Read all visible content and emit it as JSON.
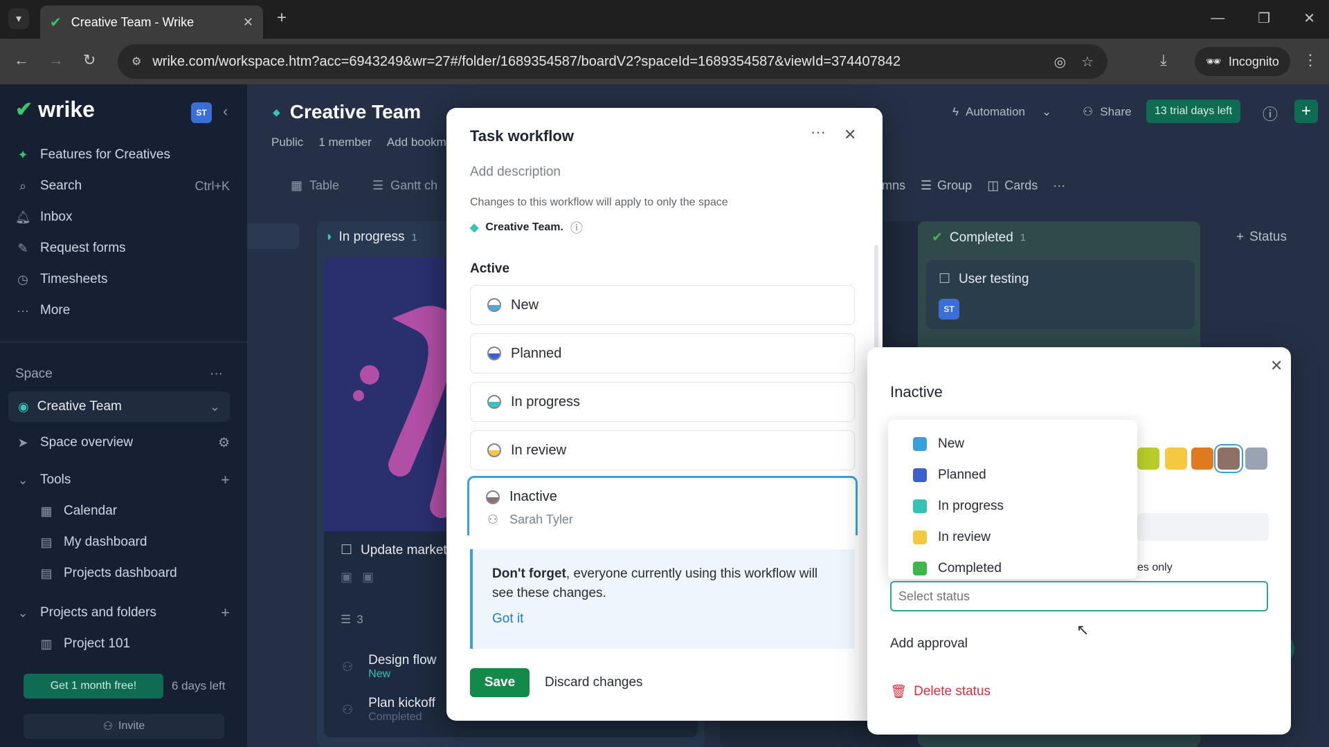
{
  "browser": {
    "tab_title": "Creative Team - Wrike",
    "url": "wrike.com/workspace.htm?acc=6943249&wr=27#/folder/1689354587/boardV2?spaceId=1689354587&viewId=374407842",
    "incognito_label": "Incognito"
  },
  "sidebar": {
    "logo": "wrike",
    "avatar": "ST",
    "items": [
      {
        "label": "Features for Creatives",
        "icon": "sparkle-icon"
      },
      {
        "label": "Search",
        "icon": "search-icon",
        "shortcut": "Ctrl+K"
      },
      {
        "label": "Inbox",
        "icon": "bell-icon"
      },
      {
        "label": "Request forms",
        "icon": "form-icon"
      },
      {
        "label": "Timesheets",
        "icon": "clock-icon"
      },
      {
        "label": "More",
        "icon": "dots-icon"
      }
    ],
    "space_header": "Space",
    "space_name": "Creative Team",
    "space_overview": "Space overview",
    "tools_header": "Tools",
    "tools": [
      "Calendar",
      "My dashboard",
      "Projects dashboard"
    ],
    "projects_header": "Projects and folders",
    "projects": [
      "Project 101"
    ],
    "promo_button": "Get 1 month free!",
    "days_left": "6 days left",
    "invite": "Invite"
  },
  "header": {
    "title": "Creative Team",
    "meta": [
      "Public",
      "1 member",
      "Add bookm"
    ],
    "automation": "Automation",
    "share": "Share",
    "trial": "13 trial days left",
    "views": [
      "Table",
      "Gantt ch"
    ],
    "view_tools": [
      "mns",
      "Group",
      "Cards"
    ]
  },
  "board": {
    "col_in_progress": "In progress",
    "col_in_progress_count": "1",
    "col_completed": "Completed",
    "col_completed_count": "1",
    "add_status": "Status",
    "card_user_testing": "User testing",
    "card_avatar": "ST",
    "card_update": "Update market",
    "subtask_count": "3",
    "subtasks": [
      {
        "name": "Design flow",
        "status": "New"
      },
      {
        "name": "Plan kickoff",
        "status": "Completed"
      }
    ]
  },
  "workflow": {
    "title": "Task workflow",
    "add_description": "Add description",
    "note": "Changes to this workflow will apply to only the space",
    "space": "Creative Team.",
    "section_active": "Active",
    "statuses": [
      {
        "name": "New",
        "color": "#4aa8e0"
      },
      {
        "name": "Planned",
        "color": "#3c5fd0"
      },
      {
        "name": "In progress",
        "color": "#36c3b8"
      },
      {
        "name": "In review",
        "color": "#f5c842"
      },
      {
        "name": "Inactive",
        "color": "#8d7167"
      }
    ],
    "selected_assignee": "Sarah Tyler",
    "callout_bold": "Don't forget",
    "callout_text": ", everyone currently using this workflow will see these changes.",
    "got_it": "Got it",
    "save": "Save",
    "discard": "Discard changes"
  },
  "detail": {
    "title": "Inactive",
    "dropdown": [
      {
        "name": "New",
        "color": "#3aa0dc"
      },
      {
        "name": "Planned",
        "color": "#3c5fd0"
      },
      {
        "name": "In progress",
        "color": "#33c2b4"
      },
      {
        "name": "In review",
        "color": "#f5c842"
      },
      {
        "name": "Completed",
        "color": "#3cb84a"
      }
    ],
    "swatches": [
      "#b8cc2a",
      "#f5c842",
      "#e07a1e",
      "#8d7167",
      "#9aa3b2"
    ],
    "partial_text": "es only",
    "select_placeholder": "Select status",
    "add_approval": "Add approval",
    "delete_status": "Delete status"
  }
}
